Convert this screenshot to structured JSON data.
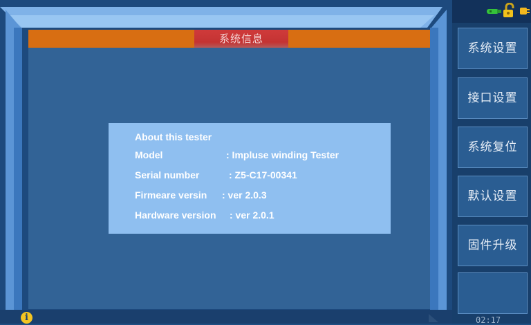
{
  "header": {
    "title": "系统信息"
  },
  "about": {
    "heading": "About this tester",
    "rows": [
      {
        "label": "Model",
        "value": ": Impluse winding Tester"
      },
      {
        "label": "Serial number",
        "value": ": Z5-C17-00341"
      },
      {
        "label": "Firmeare versin",
        "value": ": ver 2.0.3"
      },
      {
        "label": "Hardware version",
        "value": ": ver 2.0.1"
      }
    ]
  },
  "sidebar": {
    "buttons": [
      {
        "label": "系统设置"
      },
      {
        "label": "接口设置"
      },
      {
        "label": "系统复位"
      },
      {
        "label": "默认设置"
      },
      {
        "label": "固件升级"
      },
      {
        "label": ""
      }
    ]
  },
  "status": {
    "time": "02:17"
  },
  "colors": {
    "title_bar": "#d86e12",
    "title_tab": "#c43333",
    "info_card": "#8fbff0",
    "content_bg": "#326396",
    "sidebar_button": "#2a5d92"
  },
  "icons": [
    "usb-icon",
    "lock-icon",
    "plug-icon",
    "info-icon"
  ]
}
